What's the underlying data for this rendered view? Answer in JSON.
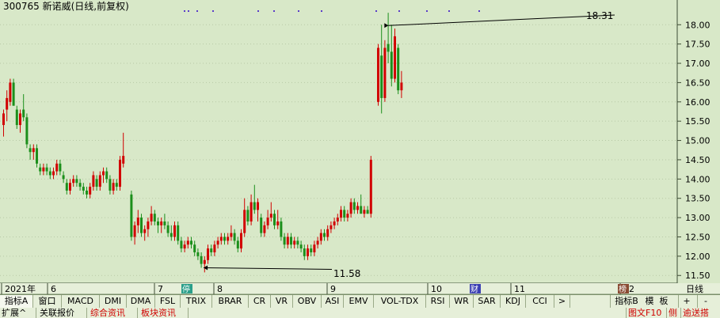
{
  "window": {
    "title": "300765 新诺威(日线,前复权)",
    "timeframe_label": "日线"
  },
  "chart_data": {
    "type": "candlestick",
    "title": "300765 新诺威(日线,前复权)",
    "ylim": [
      11.3,
      18.6
    ],
    "y_ticks": [
      "18.00",
      "17.50",
      "17.00",
      "16.50",
      "16.00",
      "15.50",
      "15.00",
      "14.50",
      "14.00",
      "13.50",
      "13.00",
      "12.50",
      "12.00",
      "11.50"
    ],
    "x_labels": [
      "2021年",
      "6",
      "7",
      "8",
      "9",
      "10",
      "11",
      "12"
    ],
    "annotations": {
      "high_label": "18.31",
      "low_label": "11.58"
    },
    "markers": [
      {
        "label": "停",
        "after_label": "7"
      },
      {
        "label": "财",
        "after_label": "10"
      },
      {
        "label": "榜",
        "after_label": "11"
      }
    ],
    "candles": [
      {
        "o": 15.4,
        "h": 15.8,
        "l": 15.1,
        "c": 15.7
      },
      {
        "o": 15.8,
        "h": 16.3,
        "l": 15.5,
        "c": 16.1
      },
      {
        "o": 16.0,
        "h": 16.6,
        "l": 15.9,
        "c": 16.5
      },
      {
        "o": 16.5,
        "h": 16.6,
        "l": 15.9,
        "c": 15.9
      },
      {
        "o": 15.8,
        "h": 15.9,
        "l": 15.3,
        "c": 15.4
      },
      {
        "o": 15.4,
        "h": 15.8,
        "l": 15.2,
        "c": 15.7
      },
      {
        "o": 15.8,
        "h": 16.2,
        "l": 15.5,
        "c": 15.6
      },
      {
        "o": 15.6,
        "h": 15.7,
        "l": 14.8,
        "c": 14.9
      },
      {
        "o": 14.8,
        "h": 14.9,
        "l": 14.5,
        "c": 14.7
      },
      {
        "o": 14.7,
        "h": 14.9,
        "l": 14.5,
        "c": 14.8
      },
      {
        "o": 14.8,
        "h": 14.9,
        "l": 14.3,
        "c": 14.4
      },
      {
        "o": 14.3,
        "h": 14.4,
        "l": 14.1,
        "c": 14.2
      },
      {
        "o": 14.2,
        "h": 14.4,
        "l": 14.1,
        "c": 14.3
      },
      {
        "o": 14.3,
        "h": 14.4,
        "l": 14.1,
        "c": 14.2
      },
      {
        "o": 14.2,
        "h": 14.3,
        "l": 14.0,
        "c": 14.1
      },
      {
        "o": 14.1,
        "h": 14.3,
        "l": 14.0,
        "c": 14.2
      },
      {
        "o": 14.2,
        "h": 14.5,
        "l": 14.1,
        "c": 14.4
      },
      {
        "o": 14.4,
        "h": 14.5,
        "l": 14.1,
        "c": 14.2
      },
      {
        "o": 14.1,
        "h": 14.2,
        "l": 13.9,
        "c": 14.0
      },
      {
        "o": 13.9,
        "h": 14.0,
        "l": 13.6,
        "c": 13.7
      },
      {
        "o": 13.7,
        "h": 14.0,
        "l": 13.6,
        "c": 13.9
      },
      {
        "o": 13.9,
        "h": 14.1,
        "l": 13.8,
        "c": 14.0
      },
      {
        "o": 14.0,
        "h": 14.1,
        "l": 13.8,
        "c": 13.9
      },
      {
        "o": 13.9,
        "h": 14.0,
        "l": 13.7,
        "c": 13.8
      },
      {
        "o": 13.8,
        "h": 13.9,
        "l": 13.6,
        "c": 13.7
      },
      {
        "o": 13.7,
        "h": 13.8,
        "l": 13.5,
        "c": 13.6
      },
      {
        "o": 13.6,
        "h": 13.9,
        "l": 13.5,
        "c": 13.8
      },
      {
        "o": 13.8,
        "h": 14.2,
        "l": 13.7,
        "c": 14.1
      },
      {
        "o": 14.0,
        "h": 14.1,
        "l": 13.7,
        "c": 13.8
      },
      {
        "o": 13.8,
        "h": 14.2,
        "l": 13.7,
        "c": 14.1
      },
      {
        "o": 14.1,
        "h": 14.3,
        "l": 13.9,
        "c": 14.2
      },
      {
        "o": 14.2,
        "h": 14.3,
        "l": 13.9,
        "c": 14.0
      },
      {
        "o": 14.0,
        "h": 14.1,
        "l": 13.6,
        "c": 13.7
      },
      {
        "o": 13.7,
        "h": 14.0,
        "l": 13.6,
        "c": 13.9
      },
      {
        "o": 13.9,
        "h": 14.0,
        "l": 13.7,
        "c": 13.8
      },
      {
        "o": 13.8,
        "h": 14.6,
        "l": 13.7,
        "c": 14.5
      },
      {
        "o": 14.4,
        "h": 15.2,
        "l": 14.3,
        "c": 14.6
      },
      {
        "o": 13.6,
        "h": 13.7,
        "l": 12.4,
        "c": 12.5
      },
      {
        "o": 12.5,
        "h": 12.9,
        "l": 12.3,
        "c": 12.8
      },
      {
        "o": 12.8,
        "h": 13.2,
        "l": 12.6,
        "c": 13.0
      },
      {
        "o": 13.0,
        "h": 13.1,
        "l": 12.5,
        "c": 12.6
      },
      {
        "o": 12.6,
        "h": 12.8,
        "l": 12.4,
        "c": 12.7
      },
      {
        "o": 12.7,
        "h": 13.0,
        "l": 12.5,
        "c": 12.9
      },
      {
        "o": 12.9,
        "h": 13.3,
        "l": 12.8,
        "c": 13.1
      },
      {
        "o": 13.1,
        "h": 13.2,
        "l": 12.8,
        "c": 12.9
      },
      {
        "o": 12.9,
        "h": 13.0,
        "l": 12.6,
        "c": 12.8
      },
      {
        "o": 12.8,
        "h": 13.0,
        "l": 12.6,
        "c": 12.9
      },
      {
        "o": 12.9,
        "h": 13.1,
        "l": 12.7,
        "c": 12.8
      },
      {
        "o": 12.8,
        "h": 12.9,
        "l": 12.5,
        "c": 12.6
      },
      {
        "o": 12.6,
        "h": 12.8,
        "l": 12.4,
        "c": 12.5
      },
      {
        "o": 12.5,
        "h": 12.9,
        "l": 12.4,
        "c": 12.8
      },
      {
        "o": 12.8,
        "h": 12.9,
        "l": 12.3,
        "c": 12.4
      },
      {
        "o": 12.4,
        "h": 12.5,
        "l": 12.1,
        "c": 12.2
      },
      {
        "o": 12.2,
        "h": 12.4,
        "l": 12.1,
        "c": 12.3
      },
      {
        "o": 12.3,
        "h": 12.5,
        "l": 12.2,
        "c": 12.4
      },
      {
        "o": 12.4,
        "h": 12.5,
        "l": 12.2,
        "c": 12.3
      },
      {
        "o": 12.3,
        "h": 12.4,
        "l": 12.0,
        "c": 12.1
      },
      {
        "o": 12.1,
        "h": 12.2,
        "l": 11.9,
        "c": 12.0
      },
      {
        "o": 12.0,
        "h": 12.1,
        "l": 11.7,
        "c": 11.8
      },
      {
        "o": 11.8,
        "h": 12.0,
        "l": 11.58,
        "c": 11.9
      },
      {
        "o": 11.9,
        "h": 12.3,
        "l": 11.8,
        "c": 12.2
      },
      {
        "o": 12.2,
        "h": 12.3,
        "l": 12.0,
        "c": 12.1
      },
      {
        "o": 12.1,
        "h": 12.4,
        "l": 12.0,
        "c": 12.3
      },
      {
        "o": 12.3,
        "h": 12.5,
        "l": 12.2,
        "c": 12.4
      },
      {
        "o": 12.4,
        "h": 12.6,
        "l": 12.3,
        "c": 12.5
      },
      {
        "o": 12.5,
        "h": 12.6,
        "l": 12.3,
        "c": 12.4
      },
      {
        "o": 12.4,
        "h": 12.6,
        "l": 12.3,
        "c": 12.5
      },
      {
        "o": 12.5,
        "h": 12.8,
        "l": 12.4,
        "c": 12.6
      },
      {
        "o": 12.6,
        "h": 12.7,
        "l": 12.3,
        "c": 12.4
      },
      {
        "o": 12.4,
        "h": 12.5,
        "l": 12.1,
        "c": 12.2
      },
      {
        "o": 12.2,
        "h": 12.7,
        "l": 12.1,
        "c": 12.6
      },
      {
        "o": 12.6,
        "h": 13.5,
        "l": 12.5,
        "c": 13.2
      },
      {
        "o": 13.2,
        "h": 13.3,
        "l": 12.8,
        "c": 12.9
      },
      {
        "o": 12.9,
        "h": 13.6,
        "l": 12.8,
        "c": 13.4
      },
      {
        "o": 13.4,
        "h": 13.85,
        "l": 13.1,
        "c": 13.2
      },
      {
        "o": 13.2,
        "h": 13.5,
        "l": 12.9,
        "c": 13.4
      },
      {
        "o": 13.0,
        "h": 13.1,
        "l": 12.5,
        "c": 12.6
      },
      {
        "o": 12.6,
        "h": 12.9,
        "l": 12.5,
        "c": 12.8
      },
      {
        "o": 12.8,
        "h": 13.2,
        "l": 12.7,
        "c": 13.0
      },
      {
        "o": 13.0,
        "h": 13.4,
        "l": 12.9,
        "c": 13.1
      },
      {
        "o": 13.1,
        "h": 13.2,
        "l": 12.7,
        "c": 12.8
      },
      {
        "o": 12.8,
        "h": 13.2,
        "l": 12.7,
        "c": 12.9
      },
      {
        "o": 12.9,
        "h": 13.0,
        "l": 12.4,
        "c": 12.5
      },
      {
        "o": 12.5,
        "h": 12.6,
        "l": 12.2,
        "c": 12.3
      },
      {
        "o": 12.3,
        "h": 12.6,
        "l": 12.2,
        "c": 12.5
      },
      {
        "o": 12.5,
        "h": 12.6,
        "l": 12.2,
        "c": 12.3
      },
      {
        "o": 12.3,
        "h": 12.5,
        "l": 12.2,
        "c": 12.4
      },
      {
        "o": 12.4,
        "h": 12.5,
        "l": 12.2,
        "c": 12.3
      },
      {
        "o": 12.3,
        "h": 12.4,
        "l": 12.1,
        "c": 12.2
      },
      {
        "o": 12.2,
        "h": 12.3,
        "l": 11.9,
        "c": 12.0
      },
      {
        "o": 12.0,
        "h": 12.3,
        "l": 11.9,
        "c": 12.2
      },
      {
        "o": 12.2,
        "h": 12.3,
        "l": 12.0,
        "c": 12.1
      },
      {
        "o": 12.1,
        "h": 12.4,
        "l": 12.0,
        "c": 12.3
      },
      {
        "o": 12.3,
        "h": 12.5,
        "l": 12.2,
        "c": 12.4
      },
      {
        "o": 12.4,
        "h": 12.7,
        "l": 12.3,
        "c": 12.6
      },
      {
        "o": 12.6,
        "h": 12.7,
        "l": 12.4,
        "c": 12.5
      },
      {
        "o": 12.5,
        "h": 12.8,
        "l": 12.4,
        "c": 12.7
      },
      {
        "o": 12.7,
        "h": 12.9,
        "l": 12.6,
        "c": 12.8
      },
      {
        "o": 12.8,
        "h": 13.0,
        "l": 12.7,
        "c": 12.9
      },
      {
        "o": 12.9,
        "h": 13.1,
        "l": 12.8,
        "c": 13.0
      },
      {
        "o": 13.0,
        "h": 13.3,
        "l": 12.9,
        "c": 13.2
      },
      {
        "o": 13.2,
        "h": 13.3,
        "l": 12.9,
        "c": 13.0
      },
      {
        "o": 13.0,
        "h": 13.2,
        "l": 12.9,
        "c": 13.1
      },
      {
        "o": 13.1,
        "h": 13.5,
        "l": 13.0,
        "c": 13.4
      },
      {
        "o": 13.4,
        "h": 13.5,
        "l": 13.1,
        "c": 13.2
      },
      {
        "o": 13.2,
        "h": 13.4,
        "l": 13.1,
        "c": 13.3
      },
      {
        "o": 13.3,
        "h": 13.6,
        "l": 13.2,
        "c": 13.1
      },
      {
        "o": 13.1,
        "h": 13.3,
        "l": 13.0,
        "c": 13.2
      },
      {
        "o": 13.2,
        "h": 13.3,
        "l": 13.1,
        "c": 13.1
      },
      {
        "o": 13.1,
        "h": 14.6,
        "l": 13.0,
        "c": 14.5
      },
      {
        "o": 16.0,
        "h": 17.5,
        "l": 15.9,
        "c": 17.4
      },
      {
        "o": 17.2,
        "h": 18.0,
        "l": 15.7,
        "c": 16.1
      },
      {
        "o": 16.1,
        "h": 17.6,
        "l": 16.0,
        "c": 17.4
      },
      {
        "o": 17.5,
        "h": 18.31,
        "l": 17.0,
        "c": 17.3
      },
      {
        "o": 17.3,
        "h": 18.0,
        "l": 16.4,
        "c": 16.6
      },
      {
        "o": 16.6,
        "h": 17.9,
        "l": 16.5,
        "c": 17.7
      },
      {
        "o": 17.4,
        "h": 17.5,
        "l": 16.2,
        "c": 16.3
      },
      {
        "o": 16.3,
        "h": 16.8,
        "l": 16.1,
        "c": 16.5
      }
    ]
  },
  "indicator_tabs": [
    {
      "label": "指标A",
      "active": true
    },
    {
      "label": "窗口",
      "active": false
    },
    {
      "label": "MACD",
      "active": false
    },
    {
      "label": "DMI",
      "active": false
    },
    {
      "label": "DMA",
      "active": false
    },
    {
      "label": "FSL",
      "active": false
    },
    {
      "label": "TRIX",
      "active": false
    },
    {
      "label": "BRAR",
      "active": false
    },
    {
      "label": "CR",
      "active": false
    },
    {
      "label": "VR",
      "active": false
    },
    {
      "label": "OBV",
      "active": false
    },
    {
      "label": "ASI",
      "active": false
    },
    {
      "label": "EMV",
      "active": false
    },
    {
      "label": "VOL-TDX",
      "active": false
    },
    {
      "label": "RSI",
      "active": false
    },
    {
      "label": "WR",
      "active": false
    },
    {
      "label": "SAR",
      "active": false
    },
    {
      "label": "KDJ",
      "active": false
    },
    {
      "label": "CCI",
      "active": false
    },
    {
      "label": ">",
      "active": false
    }
  ],
  "right_buttons": {
    "indicator_b": "指标B",
    "template": "模",
    "board": "板",
    "plus": "+",
    "minus": "-"
  },
  "bottom_tabs": [
    {
      "label": "扩展^",
      "color": "#000000"
    },
    {
      "label": "关联报价",
      "color": "#000000"
    },
    {
      "label": "综合资讯",
      "color": "#d00000"
    },
    {
      "label": "板块资讯",
      "color": "#d00000"
    }
  ],
  "bottom_right": {
    "f10_label": "图文F10",
    "side_label": "侧",
    "extra_label": "逾送搭"
  }
}
